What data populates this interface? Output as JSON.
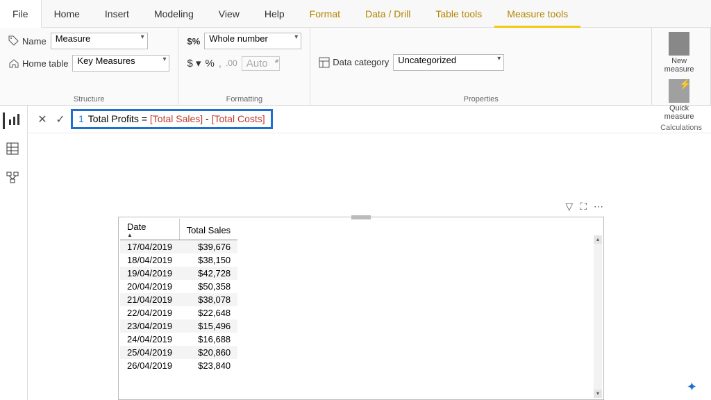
{
  "menu": {
    "file": "File",
    "tabs": [
      "Home",
      "Insert",
      "Modeling",
      "View",
      "Help",
      "Format",
      "Data / Drill",
      "Table tools",
      "Measure tools"
    ],
    "context_start": 5,
    "active": "Measure tools"
  },
  "ribbon": {
    "structure": {
      "label": "Structure",
      "name_label": "Name",
      "name_value": "Measure",
      "home_table_label": "Home table",
      "home_table_value": "Key Measures"
    },
    "formatting": {
      "label": "Formatting",
      "format_value": "Whole number",
      "auto": "Auto"
    },
    "properties": {
      "label": "Properties",
      "cat_label": "Data category",
      "cat_value": "Uncategorized"
    },
    "calculations": {
      "label": "Calculations",
      "new1": "New",
      "new2": "measure",
      "quick1": "Quick",
      "quick2": "measure"
    }
  },
  "formula": {
    "line": "1",
    "text1": "Total Profits = ",
    "ref1": "[Total Sales]",
    "text2": " - ",
    "ref2": "[Total Costs]"
  },
  "table": {
    "columns": [
      "Date",
      "Total Sales"
    ],
    "rows": [
      [
        "17/04/2019",
        "$39,676"
      ],
      [
        "18/04/2019",
        "$38,150"
      ],
      [
        "19/04/2019",
        "$42,728"
      ],
      [
        "20/04/2019",
        "$50,358"
      ],
      [
        "21/04/2019",
        "$38,078"
      ],
      [
        "22/04/2019",
        "$22,648"
      ],
      [
        "23/04/2019",
        "$15,496"
      ],
      [
        "24/04/2019",
        "$16,688"
      ],
      [
        "25/04/2019",
        "$20,860"
      ],
      [
        "26/04/2019",
        "$23,840"
      ]
    ]
  }
}
